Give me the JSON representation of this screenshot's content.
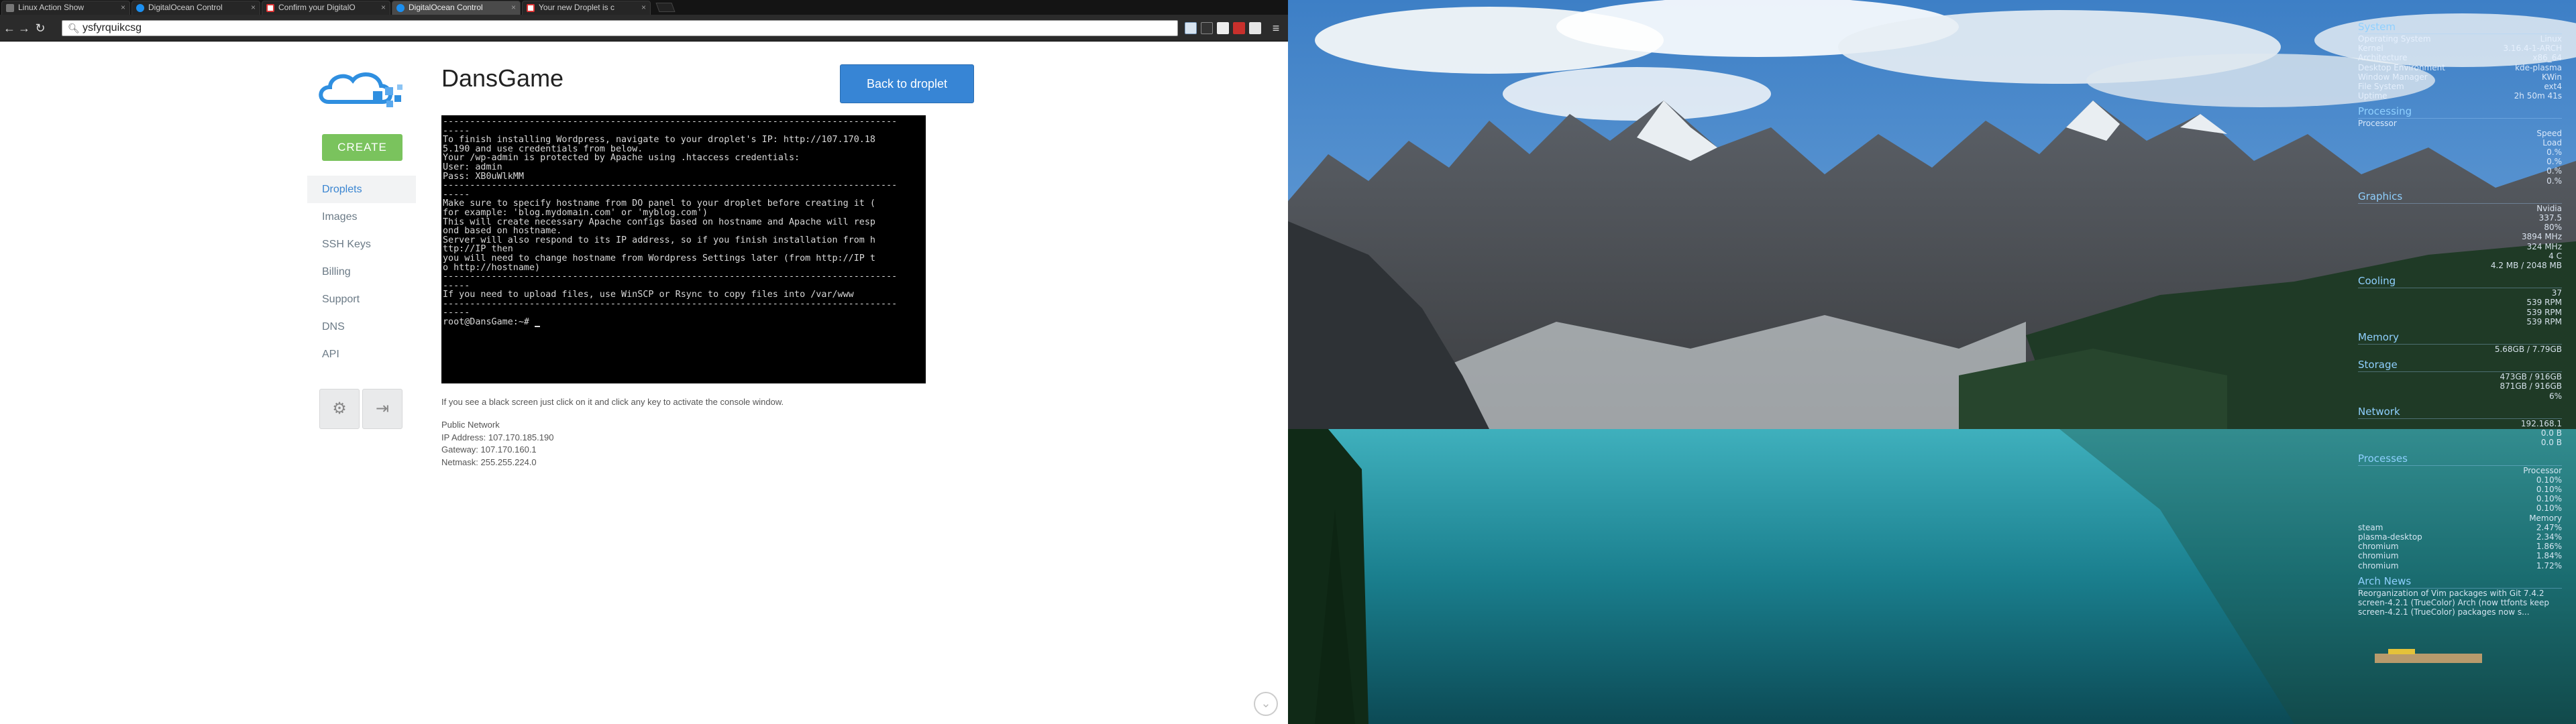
{
  "browser": {
    "tabs": [
      {
        "title": "Linux Action Show",
        "favicon": "blank-page-icon",
        "active": false
      },
      {
        "title": "DigitalOcean Control",
        "favicon": "digitalocean-icon",
        "active": false
      },
      {
        "title": "Confirm your DigitalO",
        "favicon": "gmail-icon",
        "active": false
      },
      {
        "title": "DigitalOcean Control",
        "favicon": "digitalocean-icon",
        "active": true
      },
      {
        "title": "Your new Droplet is c",
        "favicon": "gmail-icon",
        "active": false
      }
    ],
    "address": "ysfyrquikcsg"
  },
  "page": {
    "create_label": "CREATE",
    "nav": [
      {
        "label": "Droplets",
        "active": true
      },
      {
        "label": "Images",
        "active": false
      },
      {
        "label": "SSH Keys",
        "active": false
      },
      {
        "label": "Billing",
        "active": false
      },
      {
        "label": "Support",
        "active": false
      },
      {
        "label": "DNS",
        "active": false
      },
      {
        "label": "API",
        "active": false
      }
    ],
    "droplet_name": "DansGame",
    "back_label": "Back to droplet",
    "console_lines": [
      "------------------------------------------------------------------------------------",
      "-----",
      "To finish installing Wordpress, navigate to your droplet's IP: http://107.170.18",
      "5.190 and use credentials from below.",
      "",
      "Your /wp-admin is protected by Apache using .htaccess credentials:",
      "User: admin",
      "Pass: XB0uWlkMM",
      "------------------------------------------------------------------------------------",
      "-----",
      "Make sure to specify hostname from DO panel to your droplet before creating it (",
      "for example: 'blog.mydomain.com' or 'myblog.com')",
      "This will create necessary Apache configs based on hostname and Apache will resp",
      "ond based on hostname.",
      "Server will also respond to its IP address, so if you finish installation from h",
      "ttp://IP then",
      "you will need to change hostname from Wordpress Settings later (from http://IP t",
      "o http://hostname)",
      "------------------------------------------------------------------------------------",
      "-----",
      "If you need to upload files, use WinSCP or Rsync to copy files into /var/www",
      "------------------------------------------------------------------------------------",
      "-----",
      "root@DansGame:~# "
    ],
    "console_hint": "If you see a black screen just click on it and click any key to activate the console window.",
    "network": {
      "heading": "Public Network",
      "ip": "IP Address: 107.170.185.190",
      "gateway": "Gateway: 107.170.160.1",
      "netmask": "Netmask: 255.255.224.0"
    }
  },
  "conky": [
    {
      "heading": "System",
      "rows": [
        [
          "Operating System",
          "Linux"
        ],
        [
          "Kernel",
          "3.16.4-1-ARCH"
        ],
        [
          "Architecture",
          "x86_64"
        ],
        [
          "Desktop Environment",
          "kde-plasma"
        ],
        [
          "Window Manager",
          "KWin"
        ],
        [
          "File System",
          "ext4"
        ],
        [
          "Uptime",
          "2h 50m 41s"
        ]
      ]
    },
    {
      "heading": "Processing",
      "rows": [
        [
          "Processor",
          ""
        ],
        [
          "",
          "Speed"
        ],
        [
          "",
          "Load"
        ],
        [
          "",
          "0.%"
        ],
        [
          "",
          "0.%"
        ],
        [
          "",
          "0.%"
        ],
        [
          "",
          "0.%"
        ]
      ]
    },
    {
      "heading": "Graphics",
      "rows": [
        [
          "",
          "Nvidia"
        ],
        [
          "",
          "337.5"
        ],
        [
          "",
          "80%"
        ],
        [
          "",
          "3894 MHz"
        ],
        [
          "",
          "324 MHz"
        ],
        [
          "",
          "4 C"
        ],
        [
          "",
          "4.2 MB / 2048 MB"
        ]
      ]
    },
    {
      "heading": "Cooling",
      "rows": [
        [
          "",
          "37"
        ],
        [
          "",
          "539 RPM"
        ],
        [
          "",
          "539 RPM"
        ],
        [
          "",
          "539 RPM"
        ]
      ]
    },
    {
      "heading": "Memory",
      "rows": [
        [
          "",
          "5.68GB / 7.79GB"
        ]
      ]
    },
    {
      "heading": "Storage",
      "rows": [
        [
          "",
          "473GB / 916GB"
        ],
        [
          "",
          "871GB / 916GB"
        ],
        [
          "",
          "6%"
        ],
        [
          "",
          ""
        ]
      ]
    },
    {
      "heading": "Network",
      "rows": [
        [
          "",
          "192.168.1"
        ],
        [
          "",
          "0.0 B"
        ],
        [
          "",
          "0.0 B"
        ]
      ]
    },
    {
      "heading": "Processes",
      "rows": [
        [
          "",
          "Processor"
        ],
        [
          "",
          "0.10%"
        ],
        [
          "",
          "0.10%"
        ],
        [
          "",
          "0.10%"
        ],
        [
          "",
          "0.10%"
        ],
        [
          "",
          "Memory"
        ],
        [
          "steam",
          "2.47%"
        ],
        [
          "plasma-desktop",
          "2.34%"
        ],
        [
          "chromium",
          "1.86%"
        ],
        [
          "chromium",
          "1.84%"
        ],
        [
          "chromium",
          "1.72%"
        ]
      ]
    }
  ],
  "arch_news": {
    "heading": "Arch News",
    "lines": [
      "Reorganization of Vim packages with Git 7.4.2",
      "screen-4.2.1 (TrueColor) Arch (now ttfonts keep",
      "screen-4.2.1 (TrueColor) packages now s..."
    ]
  },
  "colors": {
    "accent_blue": "#3785d5",
    "create_green": "#7ac35d",
    "conky_heading": "#8fd0ff"
  }
}
